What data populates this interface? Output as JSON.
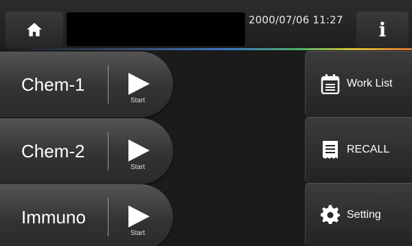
{
  "header": {
    "datetime": "2000/07/06 11:27",
    "info_label": "i",
    "home_icon": "home-icon"
  },
  "assays": [
    {
      "label": "Chem-1",
      "action": "Start"
    },
    {
      "label": "Chem-2",
      "action": "Start"
    },
    {
      "label": "Immuno",
      "action": "Start"
    }
  ],
  "side_menu": [
    {
      "label": "Work List",
      "icon": "calendar-list-icon"
    },
    {
      "label": "RECALL",
      "icon": "receipt-icon"
    },
    {
      "label": "Setting",
      "icon": "gear-icon"
    }
  ]
}
